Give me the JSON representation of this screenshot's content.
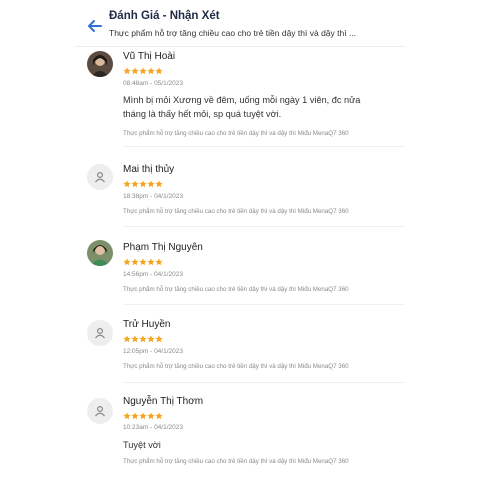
{
  "header": {
    "title": "Đánh Giá - Nhận Xét",
    "subtitle": "Thực phẩm hỗ trợ tăng chiều cao cho trẻ tiền dậy thì và dậy thì ..."
  },
  "colors": {
    "accent": "#2f6fd6",
    "star": "#f5a623"
  },
  "reviews": [
    {
      "name": "Vũ Thị Hoài",
      "rating": 5,
      "date": "08:48am - 05/1/2023",
      "comment": "Mình bị mỏi Xương về đêm, uống mỗi ngày 1 viên, đc nửa tháng là thấy hết mỏi, sp quá tuyệt vời.",
      "product": "Thực phẩm hỗ trợ tăng chiều cao cho trẻ tiền dậy thì và dậy thì Miđu MenaQ7 360",
      "avatar": "photo"
    },
    {
      "name": "Mai thị thủy",
      "rating": 5,
      "date": "18:38pm - 04/1/2023",
      "comment": "",
      "product": "Thực phẩm hỗ trợ tăng chiều cao cho trẻ tiền dậy thì và dậy thì Miđu MenaQ7 360",
      "avatar": "user-icon"
    },
    {
      "name": "Phạm Thị Nguyên",
      "rating": 5,
      "date": "14:56pm - 04/1/2023",
      "comment": "",
      "product": "Thực phẩm hỗ trợ tăng chiều cao cho trẻ tiền dậy thì và dậy thì Miđu MenaQ7 360",
      "avatar": "photo"
    },
    {
      "name": "Trử Huyền",
      "rating": 5,
      "date": "12:05pm - 04/1/2023",
      "comment": "",
      "product": "Thực phẩm hỗ trợ tăng chiều cao cho trẻ tiền dậy thì và dậy thì Miđu MenaQ7 360",
      "avatar": "user-icon"
    },
    {
      "name": "Nguyễn Thị Thơm",
      "rating": 5,
      "date": "10:23am - 04/1/2023",
      "comment": "Tuyệt vời",
      "product": "Thực phẩm hỗ trợ tăng chiều cao cho trẻ tiền dậy thì và dậy thì Miđu MenaQ7 360",
      "avatar": "user-icon"
    }
  ]
}
